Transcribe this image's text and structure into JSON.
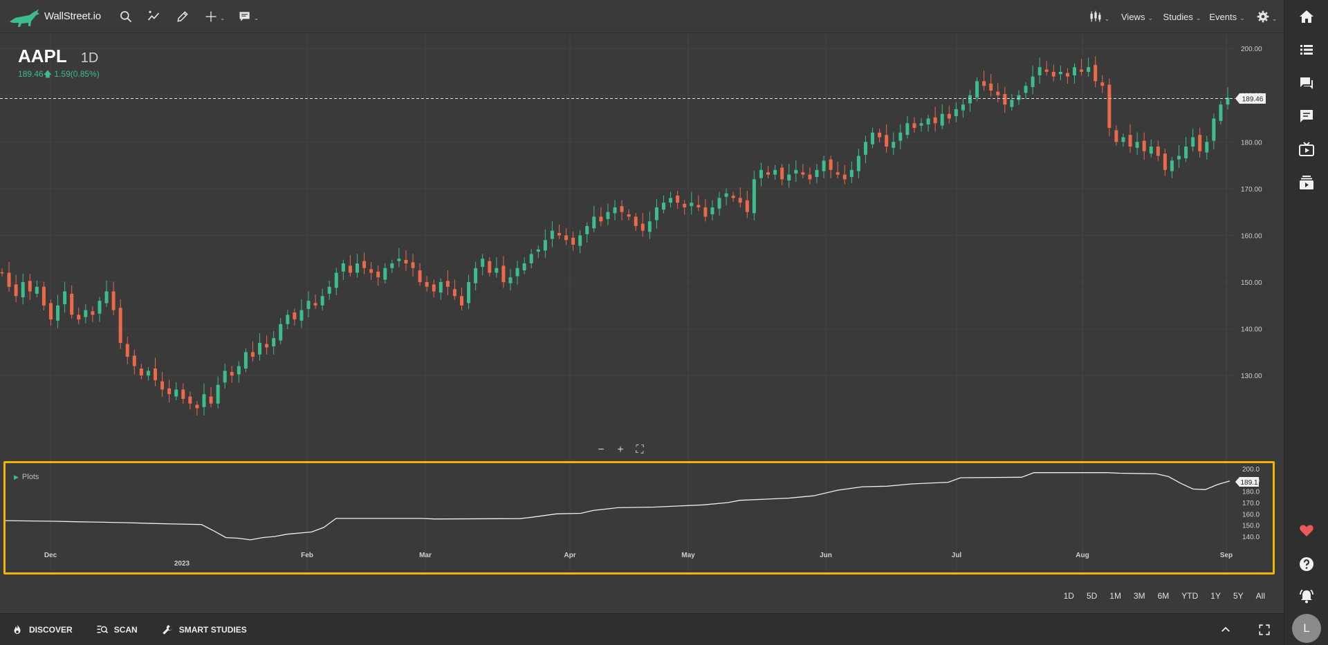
{
  "app": {
    "name": "WallStreet.io"
  },
  "toolbar": {
    "icons": [
      "search-icon",
      "trend-icon",
      "pencil-icon",
      "crosshair-icon",
      "comment-flag-icon"
    ],
    "chart_type_icon": "candles-icon",
    "views_label": "Views",
    "studies_label": "Studies",
    "events_label": "Events",
    "settings_icon": "gear-icon"
  },
  "symbol": {
    "ticker": "AAPL",
    "interval": "1D",
    "price": "189.46",
    "change": "1.59",
    "change_pct": "(0.85%)",
    "current_price_tag": "189.46"
  },
  "study": {
    "label": "Plots",
    "value_tag": "189.1",
    "y_ticks": [
      "200.0",
      "190.0",
      "180.0",
      "170.0",
      "160.0",
      "150.0",
      "140.0"
    ]
  },
  "time_axis": [
    "Dec",
    "2023",
    "Feb",
    "Mar",
    "Apr",
    "May",
    "Jun",
    "Jul",
    "Aug",
    "Sep"
  ],
  "range_buttons": [
    "1D",
    "5D",
    "1M",
    "3M",
    "6M",
    "YTD",
    "1Y",
    "5Y",
    "All"
  ],
  "bottom": {
    "discover": "DISCOVER",
    "scan": "SCAN",
    "smart_studies": "SMART STUDIES"
  },
  "user": {
    "initial": "L"
  },
  "colors": {
    "up": "#3dbd8b",
    "down": "#ea6a4a",
    "accent_border": "#f4b400",
    "background": "#3a3a3a"
  },
  "chart_data": {
    "type": "candlestick",
    "y_ticks": [
      "200.00",
      "190.00",
      "180.00",
      "170.00",
      "160.00",
      "150.00",
      "140.00",
      "130.00"
    ],
    "ylim": [
      121,
      201.5
    ],
    "x_labels": [
      "Dec",
      "2023",
      "Feb",
      "Mar",
      "Apr",
      "May",
      "Jun",
      "Jul",
      "Aug",
      "Sep"
    ],
    "closes": [
      152,
      149,
      147,
      150,
      148,
      149,
      145,
      142,
      145,
      148,
      143,
      142,
      144,
      143,
      146,
      148,
      144,
      137,
      134,
      132,
      130,
      131,
      129,
      127,
      126,
      127,
      125,
      124,
      123,
      126,
      124,
      128,
      131,
      130,
      132,
      135,
      134,
      137,
      136,
      138,
      141,
      143,
      142,
      144,
      146,
      145,
      147,
      149,
      152,
      154,
      152,
      154,
      153,
      152,
      151,
      153,
      154,
      155,
      154,
      153,
      150,
      149,
      148,
      150,
      149,
      147,
      145,
      150,
      153,
      155,
      152,
      153,
      150,
      151,
      153,
      154,
      156,
      157,
      159,
      161,
      160,
      159,
      158,
      160,
      162,
      164,
      163,
      165,
      166,
      165,
      164,
      162,
      161,
      163,
      166,
      167,
      168,
      167,
      166,
      167,
      166,
      164,
      166,
      168,
      169,
      168,
      167,
      165,
      172,
      174,
      173,
      174,
      172,
      173,
      174,
      173,
      172,
      174,
      176,
      174,
      173,
      172,
      174,
      177,
      180,
      182,
      181,
      179,
      180,
      182,
      184,
      183,
      184,
      185,
      184,
      186,
      185,
      187,
      188,
      190,
      193,
      192,
      191,
      190,
      188,
      189,
      190,
      192,
      194,
      196,
      195,
      194,
      195,
      194,
      196,
      195,
      196,
      193,
      192,
      183,
      180,
      181,
      179,
      180,
      178,
      179,
      177,
      174,
      176,
      177,
      179,
      181,
      178,
      180,
      185,
      188,
      189.46
    ],
    "study_series": [
      [
        0,
        154
      ],
      [
        0.04,
        153.5
      ],
      [
        0.06,
        153
      ],
      [
        0.08,
        152.6
      ],
      [
        0.1,
        152.2
      ],
      [
        0.12,
        151.5
      ],
      [
        0.14,
        151
      ],
      [
        0.16,
        150.6
      ],
      [
        0.17,
        145
      ],
      [
        0.18,
        139
      ],
      [
        0.19,
        138.5
      ],
      [
        0.2,
        137
      ],
      [
        0.21,
        139
      ],
      [
        0.22,
        140
      ],
      [
        0.23,
        142
      ],
      [
        0.25,
        144
      ],
      [
        0.26,
        148
      ],
      [
        0.27,
        156
      ],
      [
        0.34,
        156
      ],
      [
        0.35,
        155.5
      ],
      [
        0.42,
        155.8
      ],
      [
        0.43,
        157
      ],
      [
        0.45,
        160
      ],
      [
        0.47,
        160.5
      ],
      [
        0.48,
        163
      ],
      [
        0.5,
        165.5
      ],
      [
        0.53,
        166
      ],
      [
        0.55,
        167
      ],
      [
        0.57,
        168
      ],
      [
        0.59,
        170
      ],
      [
        0.6,
        172
      ],
      [
        0.62,
        173
      ],
      [
        0.64,
        174
      ],
      [
        0.66,
        176
      ],
      [
        0.68,
        181
      ],
      [
        0.7,
        184
      ],
      [
        0.72,
        184.5
      ],
      [
        0.74,
        186.5
      ],
      [
        0.77,
        188
      ],
      [
        0.78,
        192
      ],
      [
        0.83,
        192.5
      ],
      [
        0.84,
        196.5
      ],
      [
        0.9,
        196.5
      ],
      [
        0.91,
        196
      ],
      [
        0.94,
        195.5
      ],
      [
        0.95,
        193
      ],
      [
        0.96,
        187
      ],
      [
        0.97,
        182
      ],
      [
        0.98,
        181.5
      ],
      [
        0.99,
        186
      ],
      [
        1.0,
        189.1
      ]
    ]
  }
}
